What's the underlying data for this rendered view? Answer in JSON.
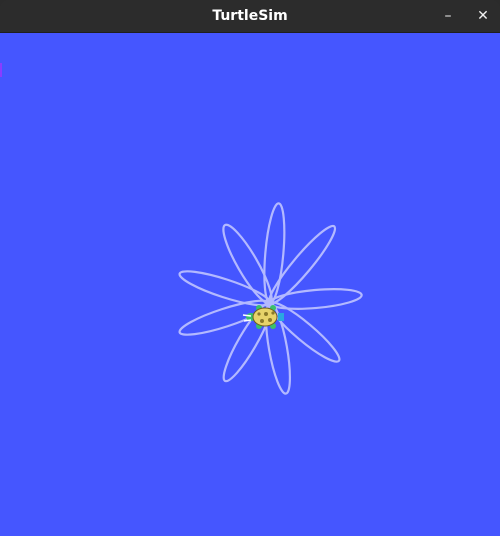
{
  "window": {
    "title": "TurtleSim",
    "minimize_glyph": "–",
    "close_glyph": "✕"
  },
  "canvas": {
    "background_color": "#4556ff",
    "pen_color": "#b3b9ff",
    "turtle": {
      "shell_color": "#e6d36a",
      "shell_spot_color": "#8a7a2a",
      "body_color": "#39c06b",
      "accent_color": "#2aa8e0"
    }
  }
}
